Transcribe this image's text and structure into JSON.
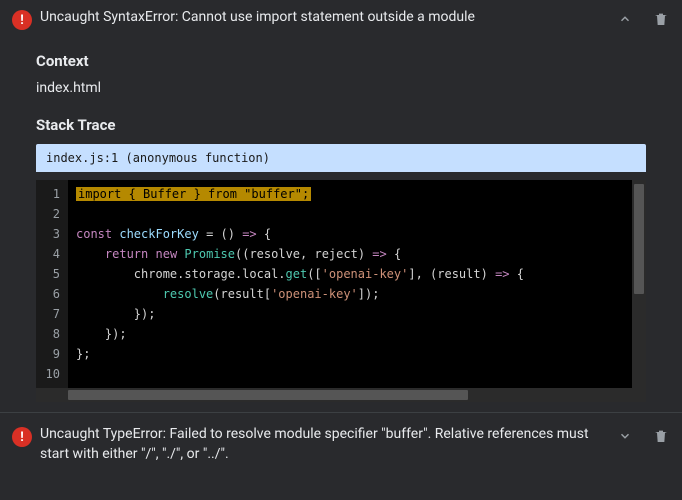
{
  "errors": [
    {
      "message": "Uncaught SyntaxError: Cannot use import statement outside a module",
      "expanded": true
    },
    {
      "message": "Uncaught TypeError: Failed to resolve module specifier \"buffer\". Relative references must start with either \"/\", \"./\", or \"../\".",
      "expanded": false
    }
  ],
  "sections": {
    "context_heading": "Context",
    "context_value": "index.html",
    "stack_heading": "Stack Trace",
    "trace_location": "index.js:1 (anonymous function)"
  },
  "code": {
    "lines": [
      {
        "n": "1",
        "html": "<span class=\"hl\">import { Buffer } from \"buffer\";</span>"
      },
      {
        "n": "2",
        "html": ""
      },
      {
        "n": "3",
        "html": "<span class=\"kw\">const</span> <span class=\"var\">checkForKey</span> = () <span class=\"kw\">=&gt;</span> {"
      },
      {
        "n": "4",
        "html": "    <span class=\"kw\">return</span> <span class=\"kw\">new</span> <span class=\"fn\">Promise</span>((resolve, reject) <span class=\"kw\">=&gt;</span> {"
      },
      {
        "n": "5",
        "html": "        chrome.storage.local.<span class=\"fn\">get</span>([<span class=\"str\">'openai-key'</span>], (result) <span class=\"kw\">=&gt;</span> {"
      },
      {
        "n": "6",
        "html": "            <span class=\"fn\">resolve</span>(result[<span class=\"str\">'openai-key'</span>]);"
      },
      {
        "n": "7",
        "html": "        });"
      },
      {
        "n": "8",
        "html": "    });"
      },
      {
        "n": "9",
        "html": "};"
      },
      {
        "n": "10",
        "html": ""
      }
    ]
  }
}
